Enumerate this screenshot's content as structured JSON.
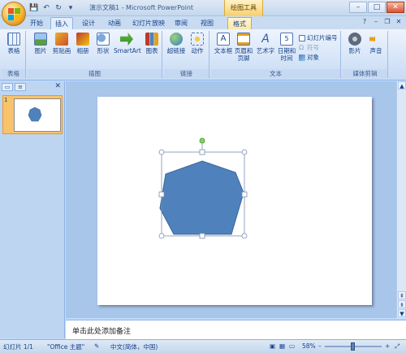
{
  "window": {
    "title": "演示文稿1 - Microsoft PowerPoint",
    "context_tool_title": "绘图工具",
    "buttons": {
      "minimize": "–",
      "maximize": "□",
      "close": "✕"
    }
  },
  "quick_access": {
    "save": "💾",
    "undo": "↶",
    "redo": "↻",
    "dropdown": "▾"
  },
  "tabs": [
    {
      "label": "开始"
    },
    {
      "label": "插入",
      "active": true
    },
    {
      "label": "设计"
    },
    {
      "label": "动画"
    },
    {
      "label": "幻灯片放映"
    },
    {
      "label": "审阅"
    },
    {
      "label": "视图"
    },
    {
      "label": "格式",
      "context": true
    }
  ],
  "ribbon": {
    "groups": {
      "table": "表格",
      "illustrations": "插图",
      "links": "链接",
      "text": "文本",
      "media": "媒体剪辑"
    },
    "buttons": {
      "table": "表格",
      "picture": "图片",
      "clipart": "剪贴画",
      "album": "相册",
      "shapes": "形状",
      "smartart": "SmartArt",
      "chart": "图表",
      "hyperlink": "超链接",
      "action": "动作",
      "textbox": "文本框",
      "header_footer": "页眉和页脚",
      "wordart": "艺术字",
      "datetime": "日期和时间",
      "slide_number": "幻灯片编号",
      "symbol": "符号",
      "object": "对象",
      "movie": "影片",
      "sound": "声音"
    }
  },
  "slides_pane": {
    "tab_slides": "▭",
    "tab_outline": "≡",
    "close": "✕",
    "thumbnails": [
      {
        "number": "1"
      }
    ]
  },
  "slide": {
    "shape": "heptagon",
    "fill_color": "#4f81bd",
    "stroke_color": "#3a679b",
    "selected": true
  },
  "notes": {
    "placeholder": "单击此处添加备注"
  },
  "statusbar": {
    "slide_info": "幻灯片 1/1",
    "theme": "\"Office 主题\"",
    "language": "中文(简体，中国)",
    "zoom": "58%"
  },
  "colors": {
    "accent": "#4f81bd",
    "ribbon_bg": "#dbe8f9",
    "selected_thumb": "#f9c36b"
  }
}
